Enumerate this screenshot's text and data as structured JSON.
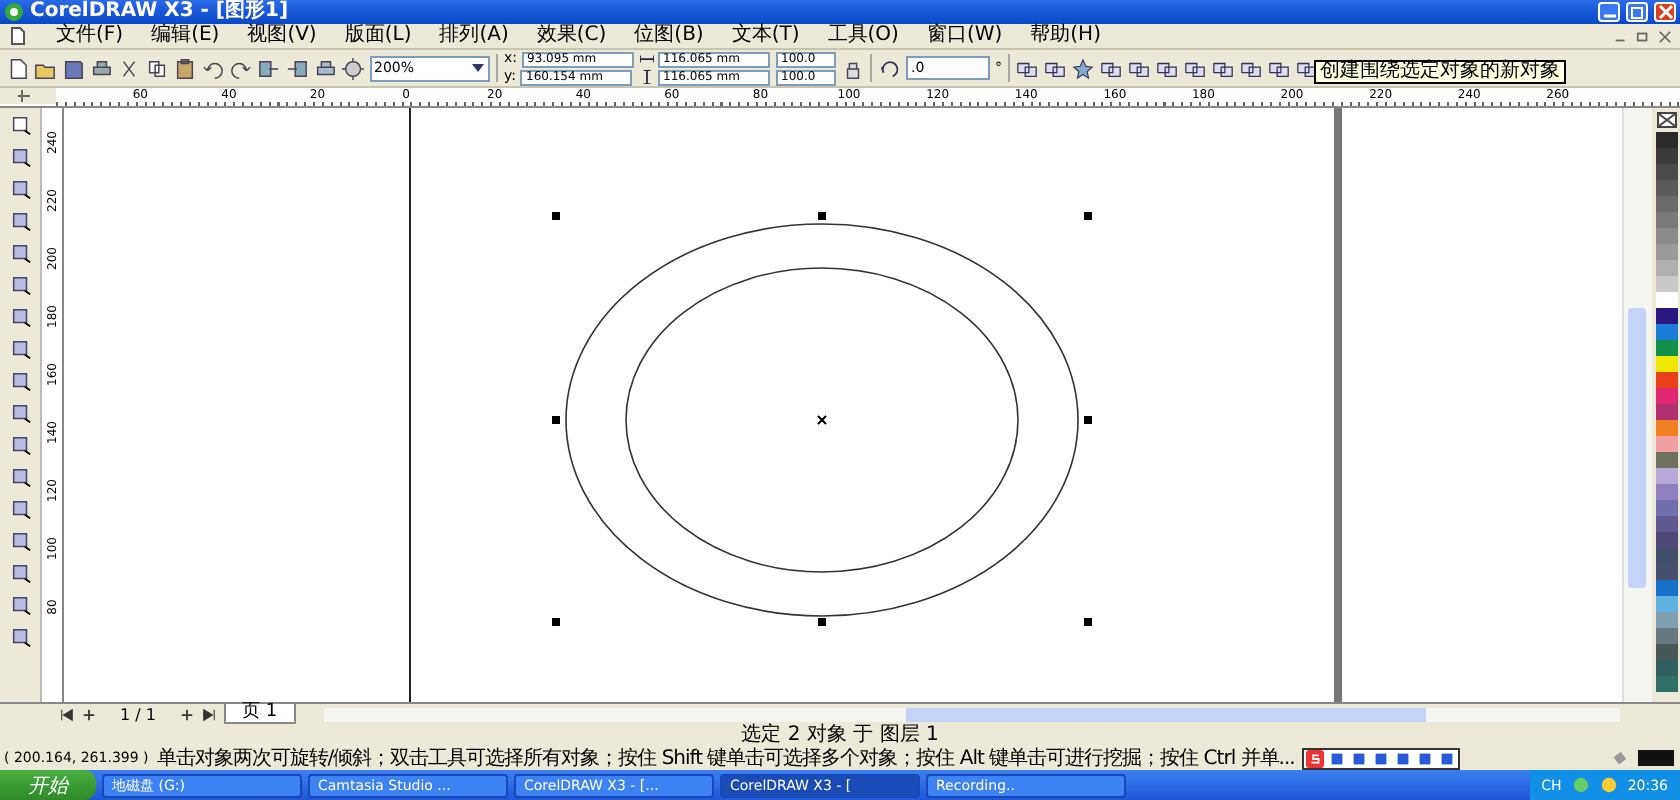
{
  "window": {
    "title": "CorelDRAW X3 - [图形1]"
  },
  "menu": [
    "文件(F)",
    "编辑(E)",
    "视图(V)",
    "版面(L)",
    "排列(A)",
    "效果(C)",
    "位图(B)",
    "文本(T)",
    "工具(O)",
    "窗口(W)",
    "帮助(H)"
  ],
  "toolbar": {
    "zoom": "200%",
    "position": [
      {
        "label": "x:",
        "value": "93.095 mm"
      },
      {
        "label": "y:",
        "value": "160.154 mm"
      }
    ],
    "size": [
      "116.065 mm",
      "116.065 mm"
    ],
    "scale": [
      "100.0",
      "100.0"
    ],
    "rotation": ".0",
    "rotation_unit": "°"
  },
  "tooltip": "创建围绕选定对象的新对象",
  "ruler": {
    "horizontal": [
      "60",
      "40",
      "20",
      "0",
      "20",
      "40",
      "60",
      "80",
      "100",
      "120",
      "140",
      "160",
      "180",
      "200",
      "220",
      "240",
      "260"
    ],
    "vertical": [
      "240",
      "220",
      "200",
      "180",
      "160",
      "140",
      "120",
      "100",
      "80"
    ]
  },
  "palette": [
    {
      "color": "#2a2a2a"
    },
    {
      "color": "#3a3a3a"
    },
    {
      "color": "#4a4a4a"
    },
    {
      "color": "#5a5a5a"
    },
    {
      "color": "#6a6a6a"
    },
    {
      "color": "#7a7a7a"
    },
    {
      "color": "#8a8a8a"
    },
    {
      "color": "#9a9a9a"
    },
    {
      "color": "#b0b0b0"
    },
    {
      "color": "#c8c8c8"
    },
    {
      "color": "#ffffff"
    },
    {
      "color": "#2a1880"
    },
    {
      "color": "#1a7ad8"
    },
    {
      "color": "#10904a"
    },
    {
      "color": "#f0e800"
    },
    {
      "color": "#e84018"
    },
    {
      "color": "#e02870"
    },
    {
      "color": "#b03070"
    },
    {
      "color": "#f08020"
    },
    {
      "color": "#f0a0a0"
    },
    {
      "color": "#707060"
    },
    {
      "color": "#b8a8d8"
    },
    {
      "color": "#9080c0"
    },
    {
      "color": "#7070b0"
    },
    {
      "color": "#605890"
    },
    {
      "color": "#504878"
    },
    {
      "color": "#405068"
    },
    {
      "color": "#485070"
    },
    {
      "color": "#1870c8"
    },
    {
      "color": "#60b0e0"
    },
    {
      "color": "#80a0b0"
    },
    {
      "color": "#687880"
    },
    {
      "color": "#485858"
    },
    {
      "color": "#306060"
    },
    {
      "color": "#307068"
    }
  ],
  "page_nav": {
    "counter": "1 / 1",
    "tabs": [
      {
        "label": "页 1",
        "selected": true
      }
    ]
  },
  "status": {
    "selection": "选定 2 对象 于 图层 1",
    "coordinates": "( 200.164, 261.399 )",
    "hint": "单击对象两次可旋转/倾斜；双击工具可选择所有对象；按住 Shift 键单击可选择多个对象；按住 Alt 键单击可进行挖掘；按住 Ctrl 并单..."
  },
  "taskbar": {
    "start": "开始",
    "items": [
      {
        "label": "地磁盘 (G:)",
        "selected": false
      },
      {
        "label": "Camtasia Studio ...",
        "selected": false
      },
      {
        "label": "CorelDRAW X3 - [...",
        "selected": false
      },
      {
        "label": "CorelDRAW X3 - [",
        "selected": true
      },
      {
        "label": "Recording..",
        "selected": false
      }
    ],
    "language": "CH",
    "clock": "20:36"
  }
}
